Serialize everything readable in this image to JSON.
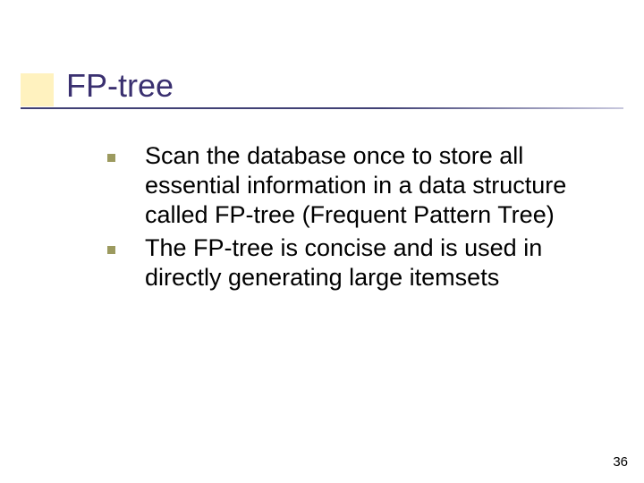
{
  "slide": {
    "title": "FP-tree",
    "bullets": [
      "Scan the database once to store all essential information in a data structure called FP-tree (Frequent Pattern Tree)",
      "The FP-tree is concise and is used in directly generating large itemsets"
    ],
    "page_number": "36"
  }
}
